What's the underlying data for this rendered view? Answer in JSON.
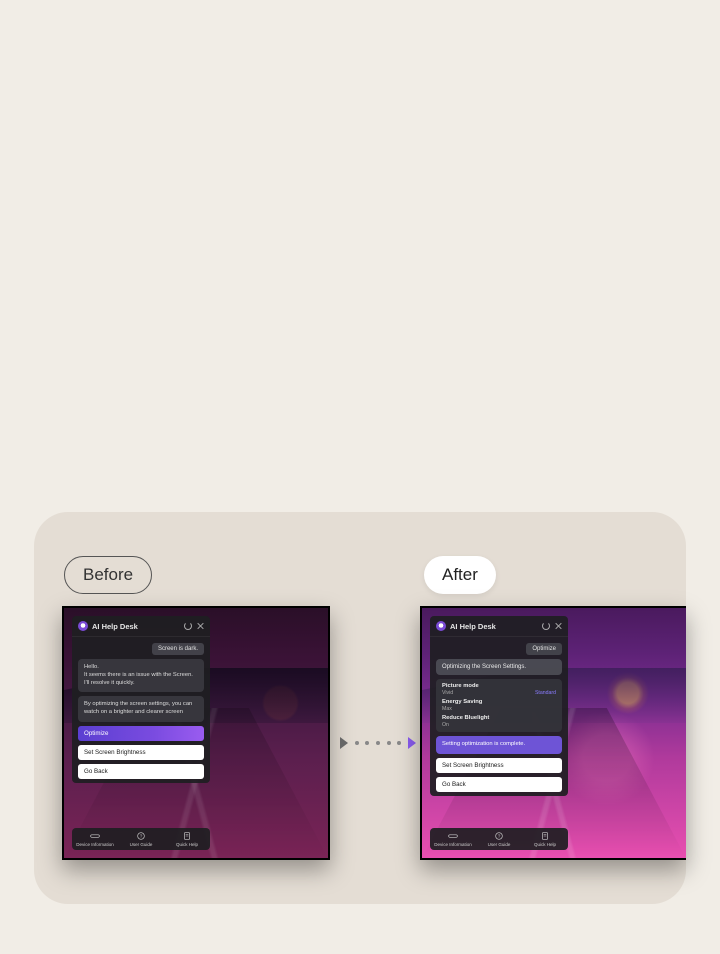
{
  "labels": {
    "before": "Before",
    "after": "After"
  },
  "panel_title": "AI Help Desk",
  "before": {
    "user_chip": "Screen is dark.",
    "msg1": "Hello.\nIt seems there is an issue with the Screen.\nI'll resolve it quickly.",
    "msg2": "By optimizing the screen settings, you can watch on a brighter and clearer screen",
    "btn_primary": "Optimize",
    "btn_white1": "Set Screen Brightness",
    "btn_white2": "Go Back"
  },
  "after": {
    "user_chip": "Optimize",
    "status": "Optimizing the Screen Settings.",
    "settings": [
      {
        "label": "Picture mode",
        "value": "Vivid",
        "link": "Standard"
      },
      {
        "label": "Energy Saving",
        "value": "Max",
        "link": ""
      },
      {
        "label": "Reduce Bluelight",
        "value": "On",
        "link": ""
      }
    ],
    "done": "Setting optimization is complete.",
    "btn_white1": "Set Screen Brightness",
    "btn_white2": "Go Back"
  },
  "footer": {
    "item1": "Device Information",
    "item2": "User Guide",
    "item3": "Quick Help"
  }
}
